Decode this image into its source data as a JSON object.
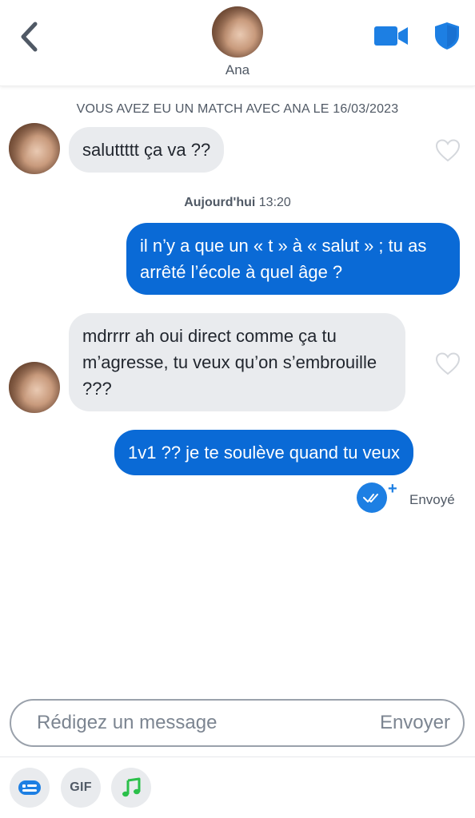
{
  "header": {
    "contact_name": "Ana",
    "accent_color": "#1d7fe3"
  },
  "conversation": {
    "match_note": "VOUS AVEZ EU UN MATCH AVEC ANA LE 16/03/2023",
    "timestamp_day": "Aujourd'hui",
    "timestamp_time": "13:20",
    "messages": [
      {
        "direction": "incoming",
        "text": "saluttttt ça va ??"
      },
      {
        "direction": "outgoing",
        "text": "il n’y a que un « t » à « salut » ; tu as arrêté l’école à quel âge ?"
      },
      {
        "direction": "incoming",
        "text": "mdrrrr ah oui direct comme ça tu m’agresse, tu veux qu’on s’embrouille ???"
      },
      {
        "direction": "outgoing",
        "text": "1v1 ?? je te soulève quand tu veux"
      }
    ],
    "status": "Envoyé"
  },
  "composer": {
    "placeholder": "Rédigez un message",
    "send_label": "Envoyer"
  },
  "toolbar": {
    "gif_label": "GIF",
    "icons": [
      "sticker-icon",
      "gif-icon",
      "music-icon"
    ]
  }
}
